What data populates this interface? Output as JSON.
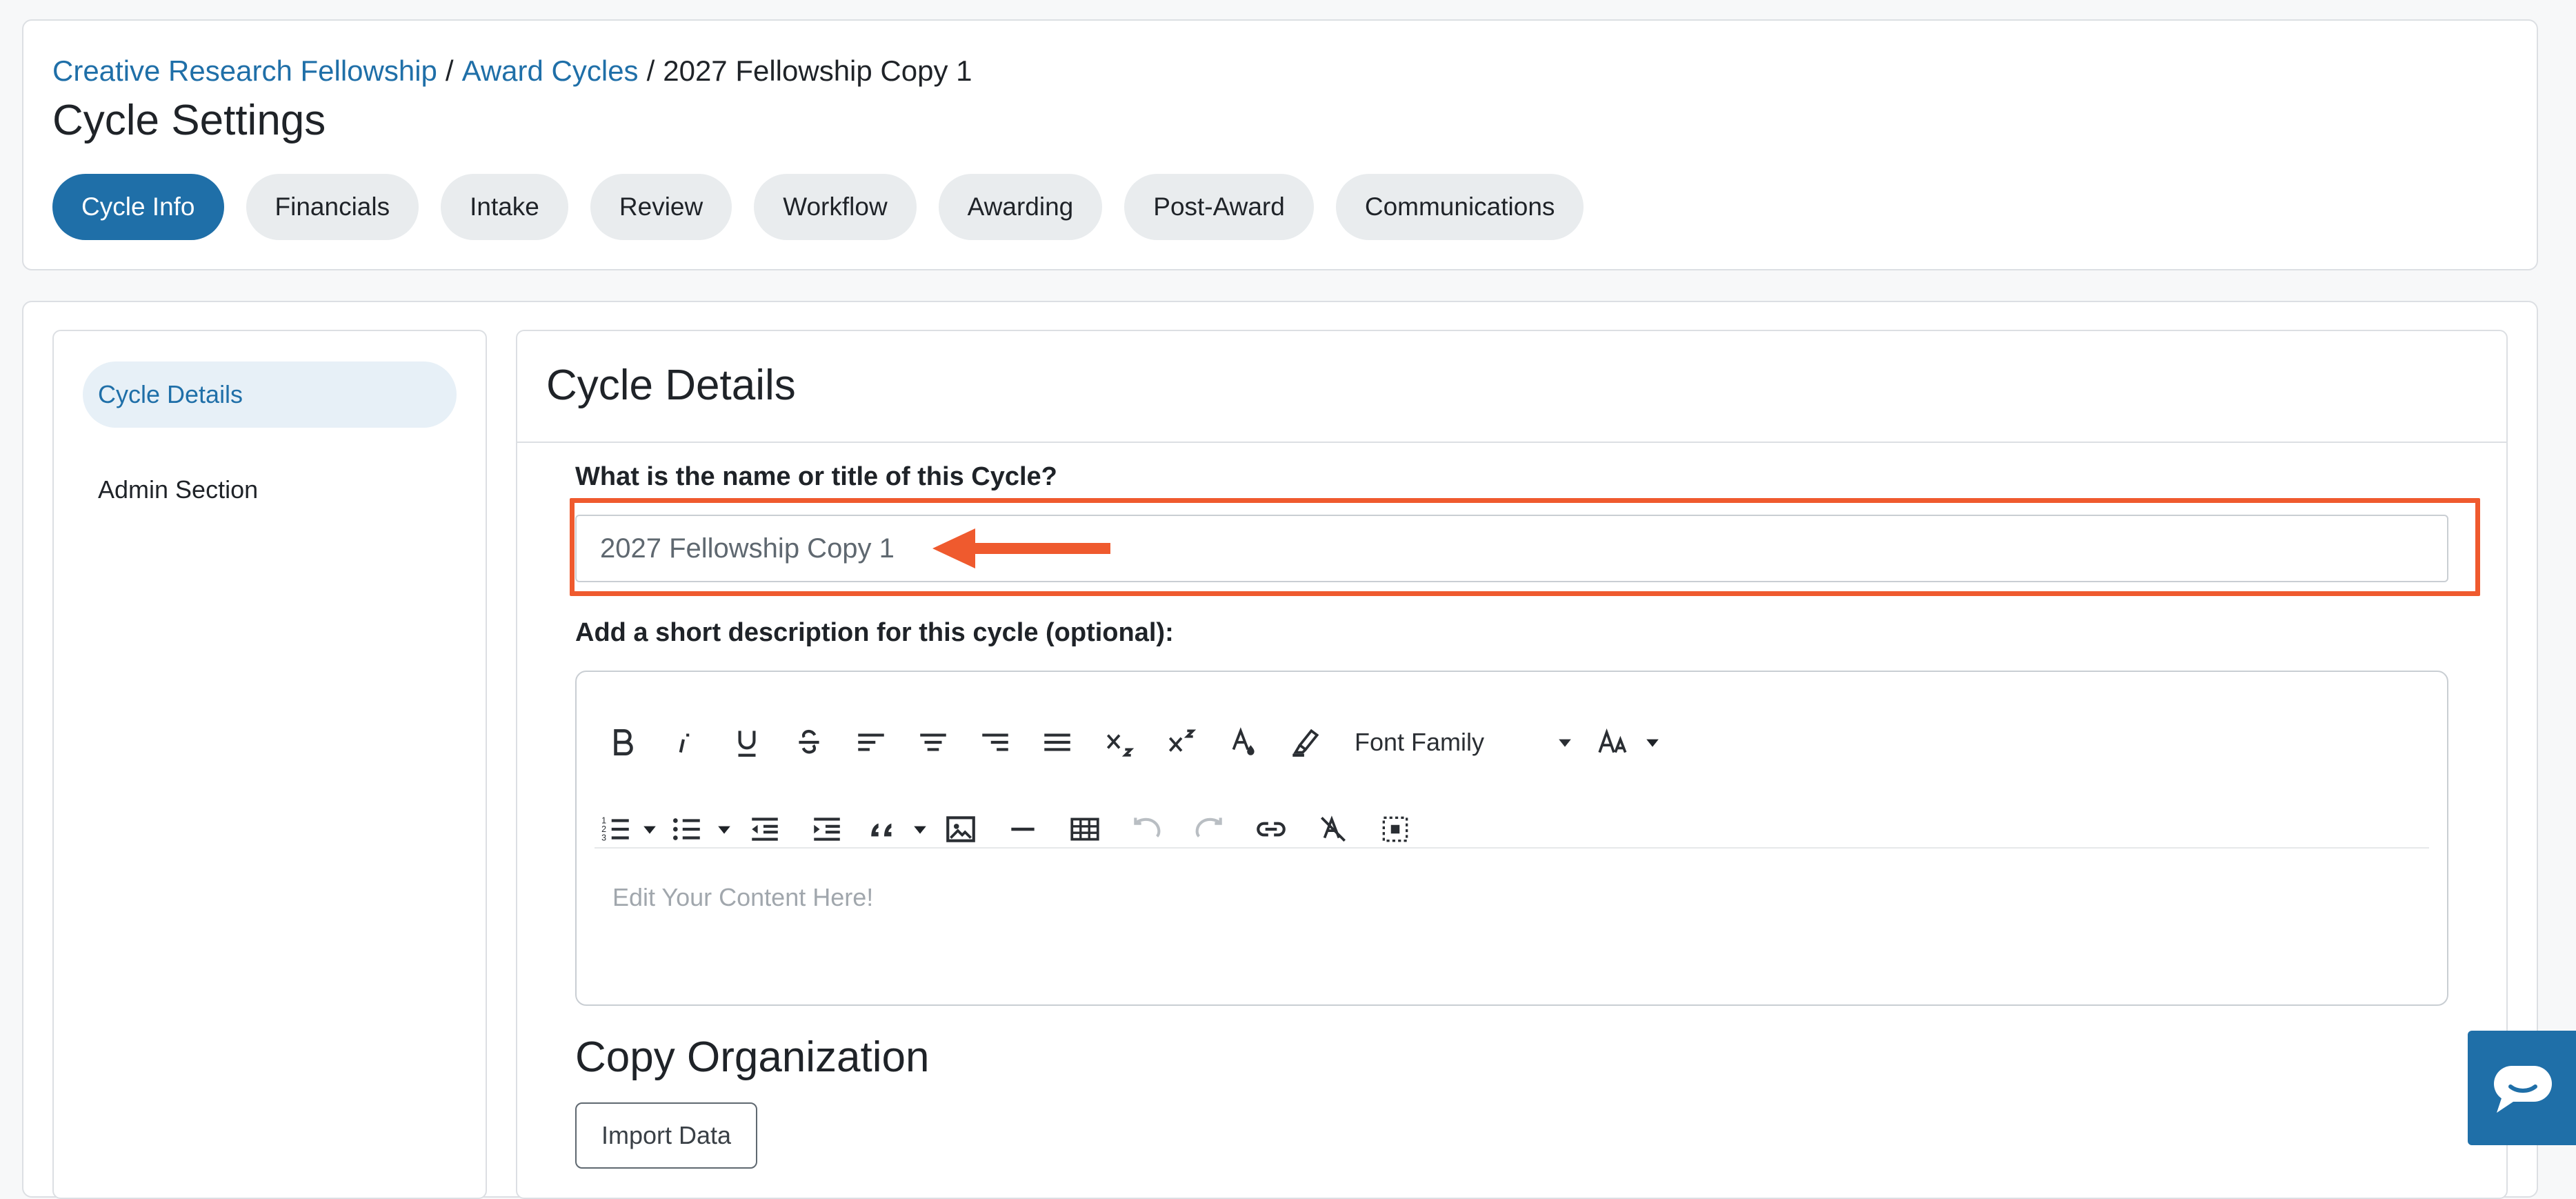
{
  "breadcrumb": {
    "items": [
      "Creative Research Fellowship",
      "Award Cycles",
      "2027 Fellowship Copy 1"
    ],
    "separator": "/"
  },
  "page_title": "Cycle Settings",
  "tabs": [
    {
      "label": "Cycle Info",
      "active": true
    },
    {
      "label": "Financials"
    },
    {
      "label": "Intake"
    },
    {
      "label": "Review"
    },
    {
      "label": "Workflow"
    },
    {
      "label": "Awarding"
    },
    {
      "label": "Post-Award"
    },
    {
      "label": "Communications"
    }
  ],
  "sidebar": {
    "items": [
      {
        "label": "Cycle Details",
        "active": true
      },
      {
        "label": "Admin Section"
      }
    ]
  },
  "content": {
    "title": "Cycle Details",
    "name_field": {
      "label": "What is the name or title of this Cycle?",
      "value": "2027 Fellowship Copy 1"
    },
    "description_field": {
      "label": "Add a short description for this cycle (optional):",
      "placeholder": "Edit Your Content Here!",
      "font_family_label": "Font Family"
    },
    "copy_org": {
      "title": "Copy Organization",
      "import_label": "Import Data"
    }
  },
  "colors": {
    "accent": "#1f6fa8",
    "highlight": "#ef5a2e"
  }
}
